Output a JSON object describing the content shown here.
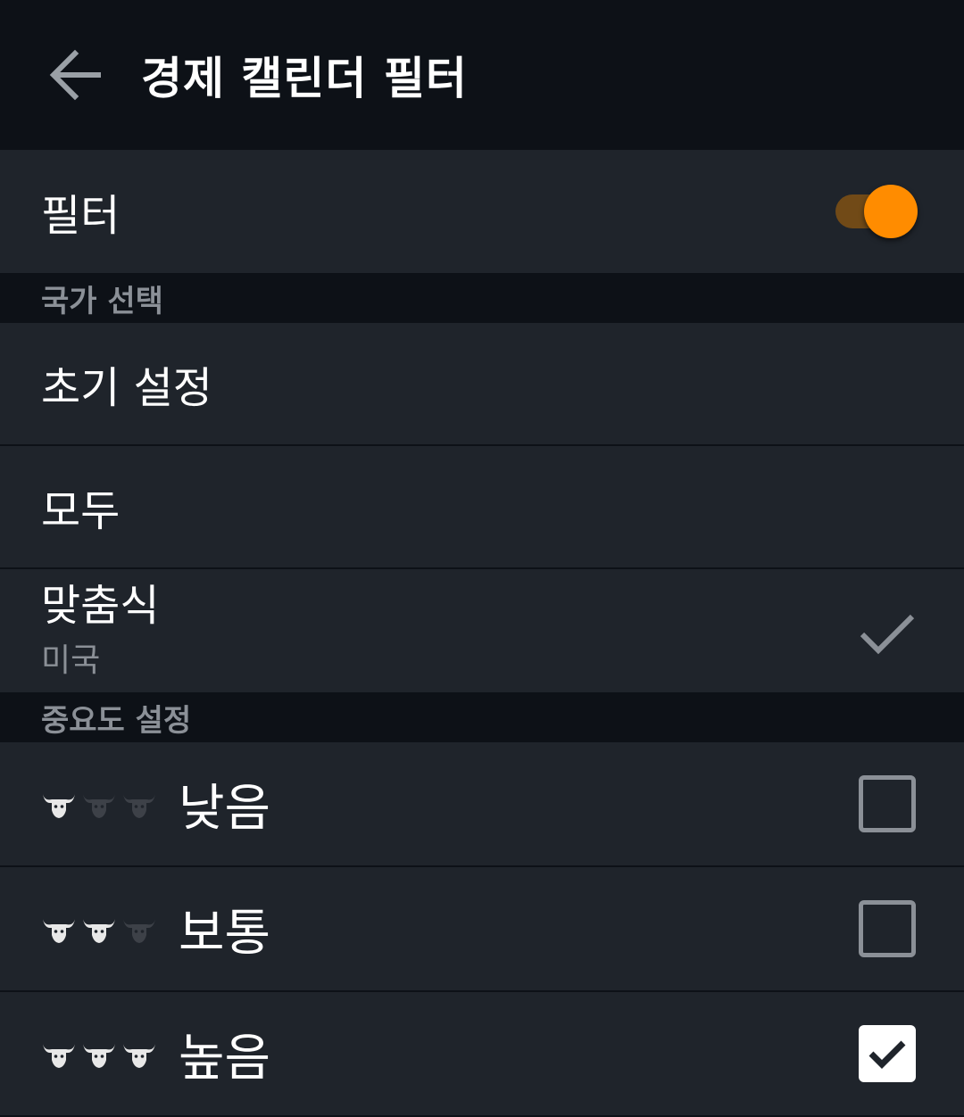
{
  "appbar": {
    "title": "경제 캘린더 필터",
    "back_icon": "arrow-left-icon"
  },
  "filter": {
    "label": "필터",
    "enabled": true,
    "accent": "#ff8c00"
  },
  "country_section": {
    "header": "국가 선택",
    "options": [
      {
        "label": "초기 설정",
        "selected": false
      },
      {
        "label": "모두",
        "selected": false
      }
    ],
    "custom": {
      "label": "맞춤식",
      "sub": "미국",
      "selected": true
    }
  },
  "importance_section": {
    "header": "중요도 설정",
    "levels": [
      {
        "label": "낮음",
        "bulls_active": 1,
        "checked": false
      },
      {
        "label": "보통",
        "bulls_active": 2,
        "checked": false
      },
      {
        "label": "높음",
        "bulls_active": 3,
        "checked": true
      }
    ]
  },
  "colors": {
    "bull_active": "#e8e8e8",
    "bull_inactive": "#3d4148"
  }
}
